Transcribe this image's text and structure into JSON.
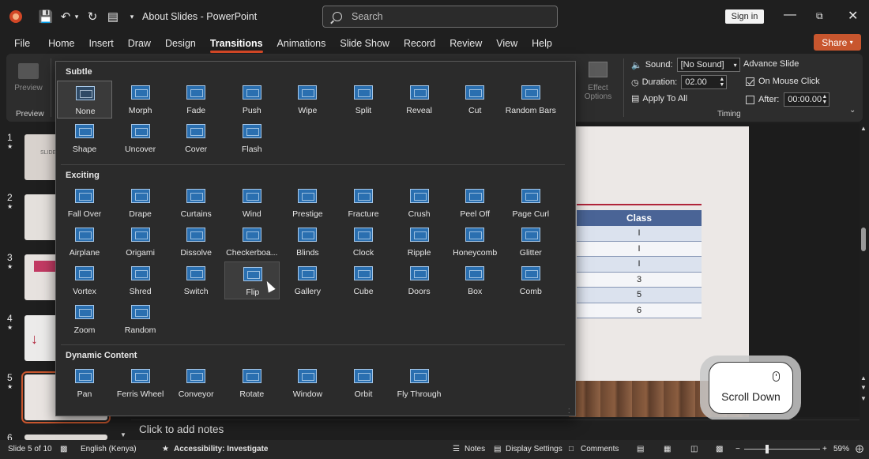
{
  "app": {
    "title": "About Slides  -  PowerPoint",
    "search_placeholder": "Search",
    "sign_in": "Sign in",
    "share": "Share",
    "accent_color": "#c8562e"
  },
  "menu": [
    "File",
    "Home",
    "Insert",
    "Draw",
    "Design",
    "Transitions",
    "Animations",
    "Slide Show",
    "Record",
    "Review",
    "View",
    "Help"
  ],
  "menu_active": "Transitions",
  "ribbon": {
    "preview_label": "Preview",
    "preview_group": "Preview",
    "effect_options": "Effect Options",
    "sound_label": "Sound:",
    "sound_value": "[No Sound]",
    "duration_label": "Duration:",
    "duration_value": "02.00",
    "apply_to_all": "Apply To All",
    "timing_group": "Timing",
    "advance_slide": "Advance Slide",
    "on_mouse_click": "On Mouse Click",
    "on_mouse_click_checked": true,
    "after_label": "After:",
    "after_value": "00:00.00",
    "after_checked": false
  },
  "gallery": {
    "sections": [
      {
        "title": "Subtle",
        "items": [
          "None",
          "Morph",
          "Fade",
          "Push",
          "Wipe",
          "Split",
          "Reveal",
          "Cut",
          "Random Bars",
          "Shape",
          "Uncover",
          "Cover",
          "Flash"
        ]
      },
      {
        "title": "Exciting",
        "items": [
          "Fall Over",
          "Drape",
          "Curtains",
          "Wind",
          "Prestige",
          "Fracture",
          "Crush",
          "Peel Off",
          "Page Curl",
          "Airplane",
          "Origami",
          "Dissolve",
          "Checkerboa...",
          "Blinds",
          "Clock",
          "Ripple",
          "Honeycomb",
          "Glitter",
          "Vortex",
          "Shred",
          "Switch",
          "Flip",
          "Gallery",
          "Cube",
          "Doors",
          "Box",
          "Comb",
          "Zoom",
          "Random"
        ]
      },
      {
        "title": "Dynamic Content",
        "items": [
          "Pan",
          "Ferris Wheel",
          "Conveyor",
          "Rotate",
          "Window",
          "Orbit",
          "Fly Through"
        ]
      }
    ],
    "selected": "None",
    "hovered": "Flip"
  },
  "thumbnails": {
    "numbers": [
      "1",
      "2",
      "3",
      "4",
      "5",
      "6"
    ],
    "active": "5",
    "slide1_text": "SLIDES"
  },
  "slide": {
    "table_header": "Class",
    "table_values": [
      "I",
      "I",
      "I",
      "3",
      "5",
      "6"
    ]
  },
  "overlay": {
    "scroll_text": "Scroll Down"
  },
  "notes_placeholder": "Click to add notes",
  "status": {
    "slide_info": "Slide 5 of 10",
    "language": "English (Kenya)",
    "accessibility": "Accessibility: Investigate",
    "notes": "Notes",
    "display_settings": "Display Settings",
    "comments": "Comments",
    "zoom": "59%"
  }
}
